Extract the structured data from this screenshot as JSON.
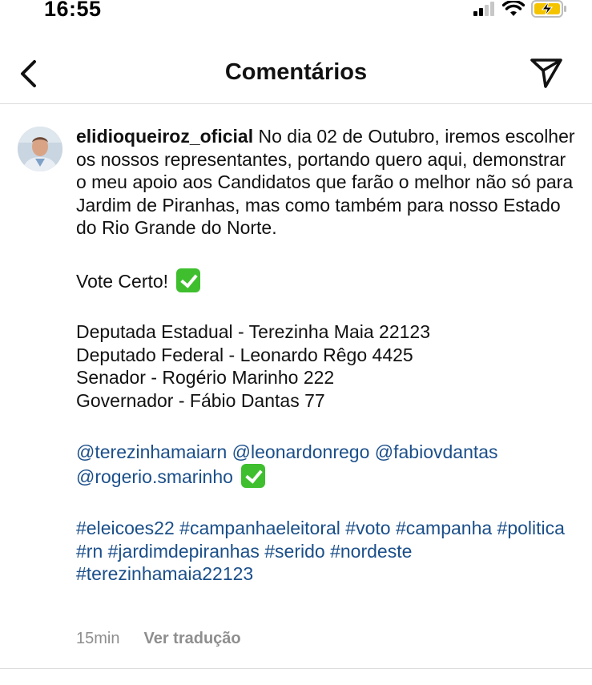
{
  "status_bar": {
    "time": "16:55",
    "icons": [
      "signal-icon",
      "wifi-icon",
      "battery-charging-icon"
    ],
    "battery_color": "#f5c400"
  },
  "header": {
    "title": "Comentários",
    "back_icon": "chevron-left-icon",
    "send_icon": "paper-plane-icon"
  },
  "comment": {
    "username": "elidioqueiroz_oficial",
    "intro": " No dia 02 de Outubro, iremos escolher os nossos representantes, portando quero aqui, demonstrar o meu apoio aos Candidatos que farão o melhor não só para Jardim de Piranhas, mas como também para nosso Estado do Rio Grande do Norte.",
    "vote_line": "Vote Certo!",
    "candidates": [
      "Deputada Estadual - Terezinha Maia 22123",
      "Deputado Federal - Leonardo Rêgo 4425",
      "Senador - Rogério Marinho 222",
      "Governador - Fábio Dantas 77"
    ],
    "mentions": [
      "@terezinhamaiarn",
      "@leonardonrego",
      "@fabiovdantas",
      "@rogerio.smarinho"
    ],
    "hashtags": [
      "#eleicoes22",
      "#campanhaeleitoral",
      "#voto",
      "#campanha",
      "#politica",
      "#rn",
      "#jardimdepiranhas",
      "#serido",
      "#nordeste",
      "#terezinhamaia22123"
    ],
    "timestamp": "15min",
    "translate_label": "Ver tradução",
    "link_color": "#1b4f8a",
    "check_color": "#3fbf2e"
  }
}
